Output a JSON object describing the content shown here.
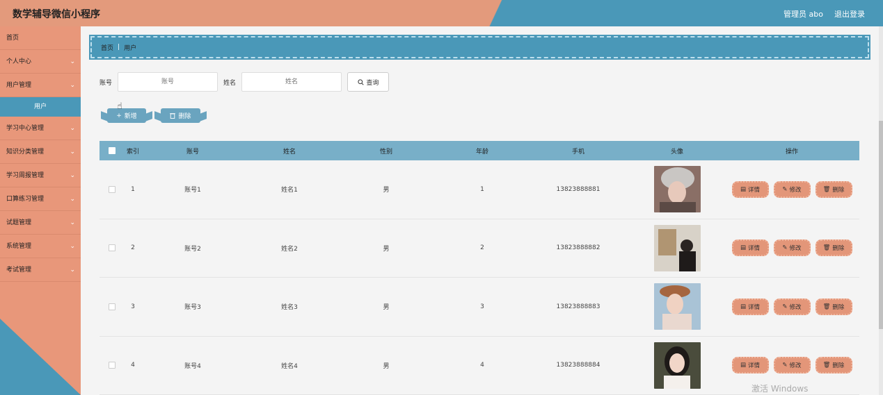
{
  "header": {
    "title": "数学辅导微信小程序",
    "user": "管理员 abo",
    "logout": "退出登录"
  },
  "sidebar": {
    "items": [
      {
        "label": "首页",
        "chevron": ""
      },
      {
        "label": "个人中心",
        "chevron": "⌄"
      },
      {
        "label": "用户管理",
        "chevron": "⌄"
      },
      {
        "label": "学习中心管理",
        "chevron": "⌄"
      },
      {
        "label": "知识分类管理",
        "chevron": "⌄"
      },
      {
        "label": "学习周报管理",
        "chevron": "⌄"
      },
      {
        "label": "口算练习管理",
        "chevron": "⌄"
      },
      {
        "label": "试题管理",
        "chevron": "⌄"
      },
      {
        "label": "系统管理",
        "chevron": "⌄"
      },
      {
        "label": "考试管理",
        "chevron": "⌄"
      }
    ],
    "sub_item": "用户"
  },
  "breadcrumb": {
    "home": "首页",
    "sep": "|",
    "current": "用户"
  },
  "search": {
    "account_label": "账号",
    "account_placeholder": "账号",
    "name_label": "姓名",
    "name_placeholder": "姓名",
    "query_label": "查询"
  },
  "actions": {
    "add_label": "新增",
    "delete_label": "删除"
  },
  "table": {
    "headers": {
      "index": "索引",
      "account": "账号",
      "name": "姓名",
      "sex": "性别",
      "age": "年龄",
      "phone": "手机",
      "avatar": "头像",
      "ops": "操作"
    },
    "rows": [
      {
        "index": "1",
        "account": "账号1",
        "name": "姓名1",
        "sex": "男",
        "age": "1",
        "phone": "13823888881"
      },
      {
        "index": "2",
        "account": "账号2",
        "name": "姓名2",
        "sex": "男",
        "age": "2",
        "phone": "13823888882"
      },
      {
        "index": "3",
        "account": "账号3",
        "name": "姓名3",
        "sex": "男",
        "age": "3",
        "phone": "13823888883"
      },
      {
        "index": "4",
        "account": "账号4",
        "name": "姓名4",
        "sex": "男",
        "age": "4",
        "phone": "13823888884"
      }
    ],
    "op_labels": {
      "detail": "详情",
      "edit": "修改",
      "delete": "删除"
    }
  },
  "watermark": "激活 Windows",
  "colors": {
    "accent_orange": "#e39a7c",
    "accent_blue": "#4a98b8"
  }
}
